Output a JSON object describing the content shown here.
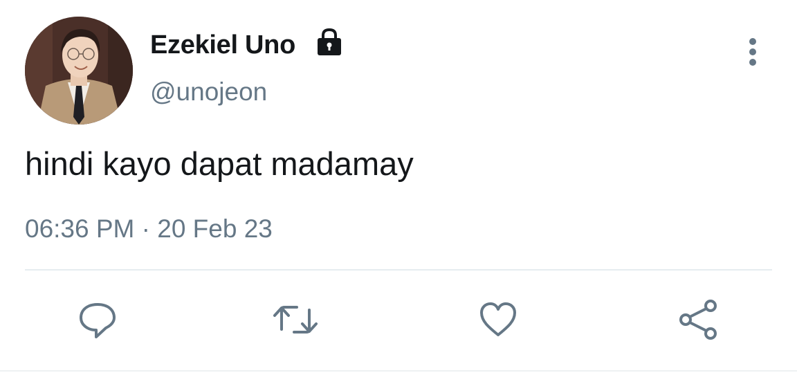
{
  "tweet": {
    "author": {
      "display_name": "Ezekiel Uno",
      "handle": "@unojeon",
      "protected_icon": "lock-icon",
      "avatar": "profile-photo"
    },
    "text": "hindi kayo dapat madamay",
    "timestamp": "06:36 PM · 20 Feb 23",
    "more_icon": "more-vertical-icon"
  },
  "actions": [
    {
      "name": "reply",
      "icon": "comment-icon"
    },
    {
      "name": "retweet",
      "icon": "retweet-icon"
    },
    {
      "name": "like",
      "icon": "heart-icon"
    },
    {
      "name": "share",
      "icon": "share-icon"
    }
  ],
  "colors": {
    "text_primary": "#14171a",
    "text_secondary": "#657786",
    "divider": "#e6ecf0",
    "icon": "#657786"
  }
}
